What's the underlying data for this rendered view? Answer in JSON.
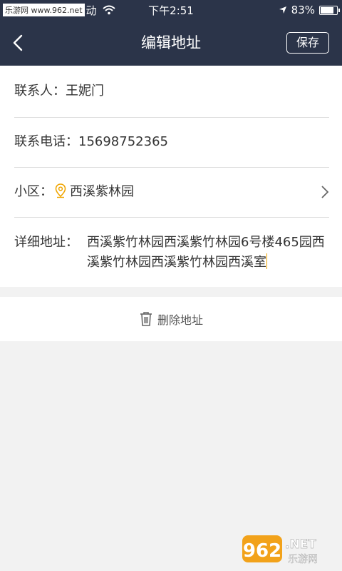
{
  "statusbar": {
    "watermark": "乐游网 www.962.net",
    "carrier": "动",
    "time": "下午2:51",
    "battery": "83%"
  },
  "navbar": {
    "title": "编辑地址",
    "save_label": "保存"
  },
  "form": {
    "contact": {
      "label": "联系人：",
      "value": "王妮门"
    },
    "phone": {
      "label": "联系电话：",
      "value": "15698752365"
    },
    "community": {
      "label": "小区：",
      "value": "西溪紫林园"
    },
    "detail": {
      "label": "详细地址：",
      "value": "西溪紫竹林园西溪紫竹林园6号楼465园西溪紫竹林园西溪紫竹林园西溪室"
    }
  },
  "delete": {
    "label": "删除地址"
  },
  "watermark_bottom": {
    "number": "962",
    "suffix": ".NET",
    "sub": "乐游网"
  },
  "colors": {
    "navbar": "#2b3449",
    "accent": "#f0a500",
    "background": "#f2f2f2"
  }
}
